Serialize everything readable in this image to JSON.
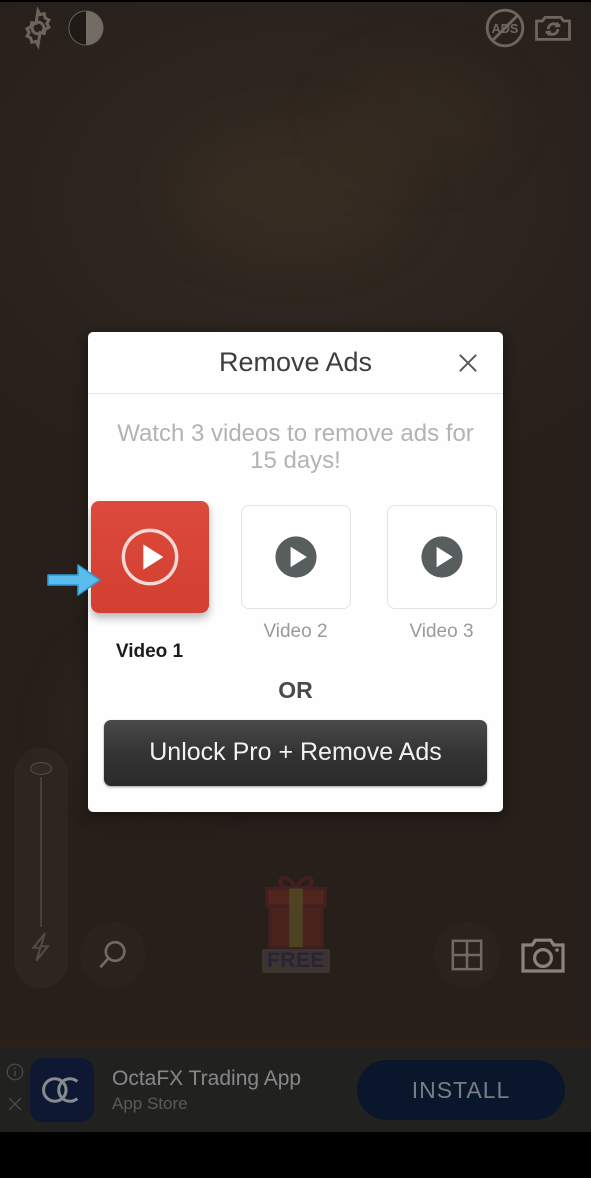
{
  "app": {
    "background_color": "#2a2219",
    "accent_red": "#d8443a",
    "arrow_color": "#5bbcee"
  },
  "topbar": {
    "items": [
      {
        "name": "settings-gear-icon",
        "label": "Settings"
      },
      {
        "name": "contrast-icon",
        "label": "Contrast"
      },
      {
        "name": "no-ads-badge-icon",
        "label": "ADS"
      },
      {
        "name": "flip-camera-icon",
        "label": "Flip camera"
      }
    ]
  },
  "camera_controls": {
    "zoom_slider": {
      "label": "Zoom",
      "flash_icon": "flash-icon"
    },
    "search_label": "Search",
    "gift_label": "FREE",
    "focus_label": "Focus",
    "shutter_label": "Shutter"
  },
  "dialog": {
    "title": "Remove Ads",
    "close_label": "✕",
    "subtitle": "Watch 3 videos to remove ads for 15 days!",
    "videos": [
      {
        "label": "Video 1",
        "state": "selected"
      },
      {
        "label": "Video 2",
        "state": "default"
      },
      {
        "label": "Video 3",
        "state": "default"
      }
    ],
    "or_label": "OR",
    "unlock_button": "Unlock Pro + Remove Ads"
  },
  "ad_banner": {
    "title": "OctaFX Trading App",
    "subtitle": "App Store",
    "install_label": "INSTALL",
    "logo_text": "OC",
    "info_icon": "info-icon",
    "close_icon": "close-icon"
  }
}
